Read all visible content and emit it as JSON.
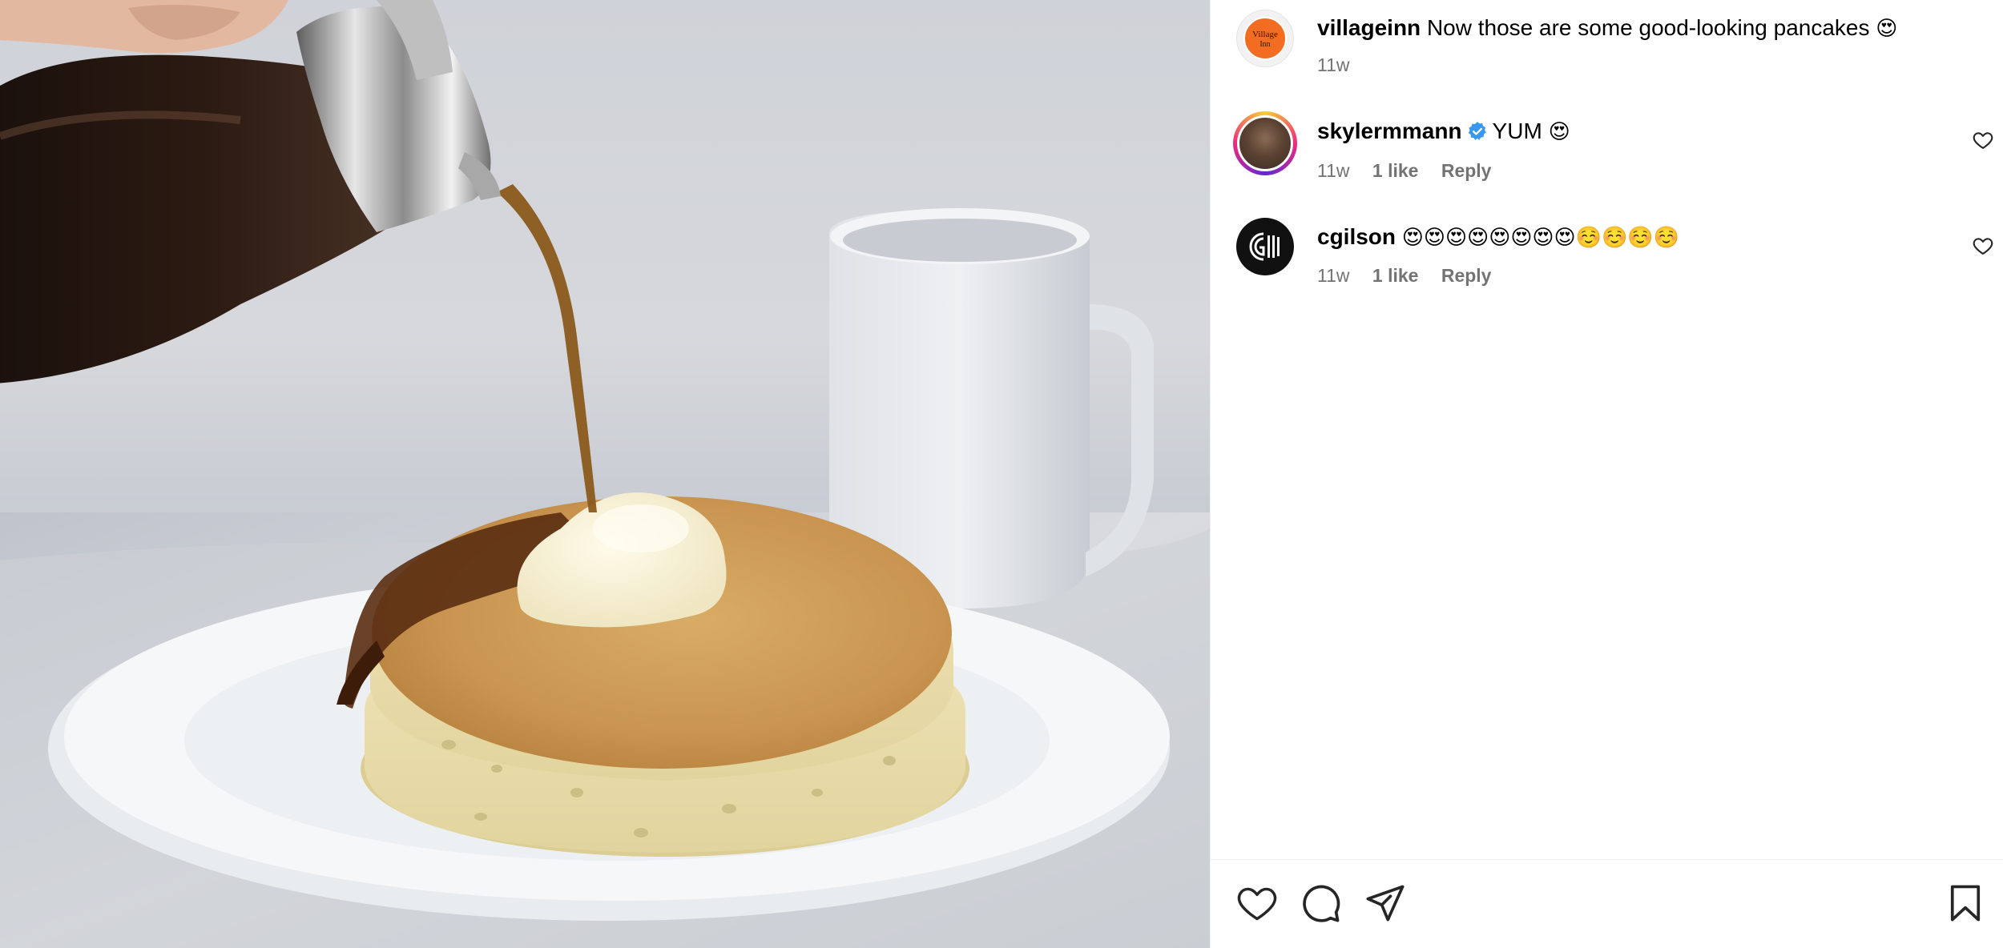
{
  "comments": [
    {
      "username": "villageinn",
      "text": "Now those are some good-looking pancakes",
      "emoji": "😍",
      "time": "11w",
      "avatar_text_1": "Village",
      "avatar_text_2": "Inn"
    },
    {
      "username": "skylermmann",
      "verified": true,
      "text": "YUM",
      "emoji": "😍",
      "time": "11w",
      "likes": "1 like",
      "reply": "Reply"
    },
    {
      "username": "cgilson",
      "text": "",
      "emoji": "😍😍😍😍😍😍😍😍☺️☺️☺️☺️",
      "time": "11w",
      "likes": "1 like",
      "reply": "Reply"
    }
  ],
  "icons": {
    "like": "heart-icon",
    "comment": "comment-icon",
    "share": "share-icon",
    "save": "bookmark-icon"
  },
  "colors": {
    "verified": "#3897f0",
    "meta_gray": "#737373",
    "story_ring_start": "#f9ce34",
    "story_ring_mid": "#ee2a7b",
    "story_ring_end": "#6228d7"
  }
}
